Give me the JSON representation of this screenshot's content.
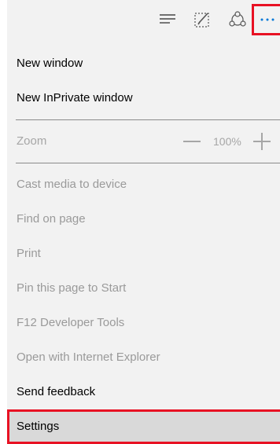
{
  "toolbar": {
    "icons": [
      "hub-icon",
      "web-note-icon",
      "share-icon",
      "more-icon"
    ],
    "more_label": "···"
  },
  "menu": {
    "new_window": "New window",
    "new_inprivate": "New InPrivate window",
    "zoom": {
      "label": "Zoom",
      "value": "100%"
    },
    "items": [
      {
        "label": "Cast media to device",
        "enabled": false
      },
      {
        "label": "Find on page",
        "enabled": false
      },
      {
        "label": "Print",
        "enabled": false
      },
      {
        "label": "Pin this page to Start",
        "enabled": false
      },
      {
        "label": "F12 Developer Tools",
        "enabled": false
      },
      {
        "label": "Open with Internet Explorer",
        "enabled": false
      },
      {
        "label": "Send feedback",
        "enabled": true
      },
      {
        "label": "Settings",
        "enabled": true,
        "highlighted": true
      }
    ]
  },
  "colors": {
    "accent": "#0078d7",
    "highlight_border": "#e81123",
    "panel_bg": "#f2f2f2",
    "disabled_text": "#9a9a9a"
  }
}
